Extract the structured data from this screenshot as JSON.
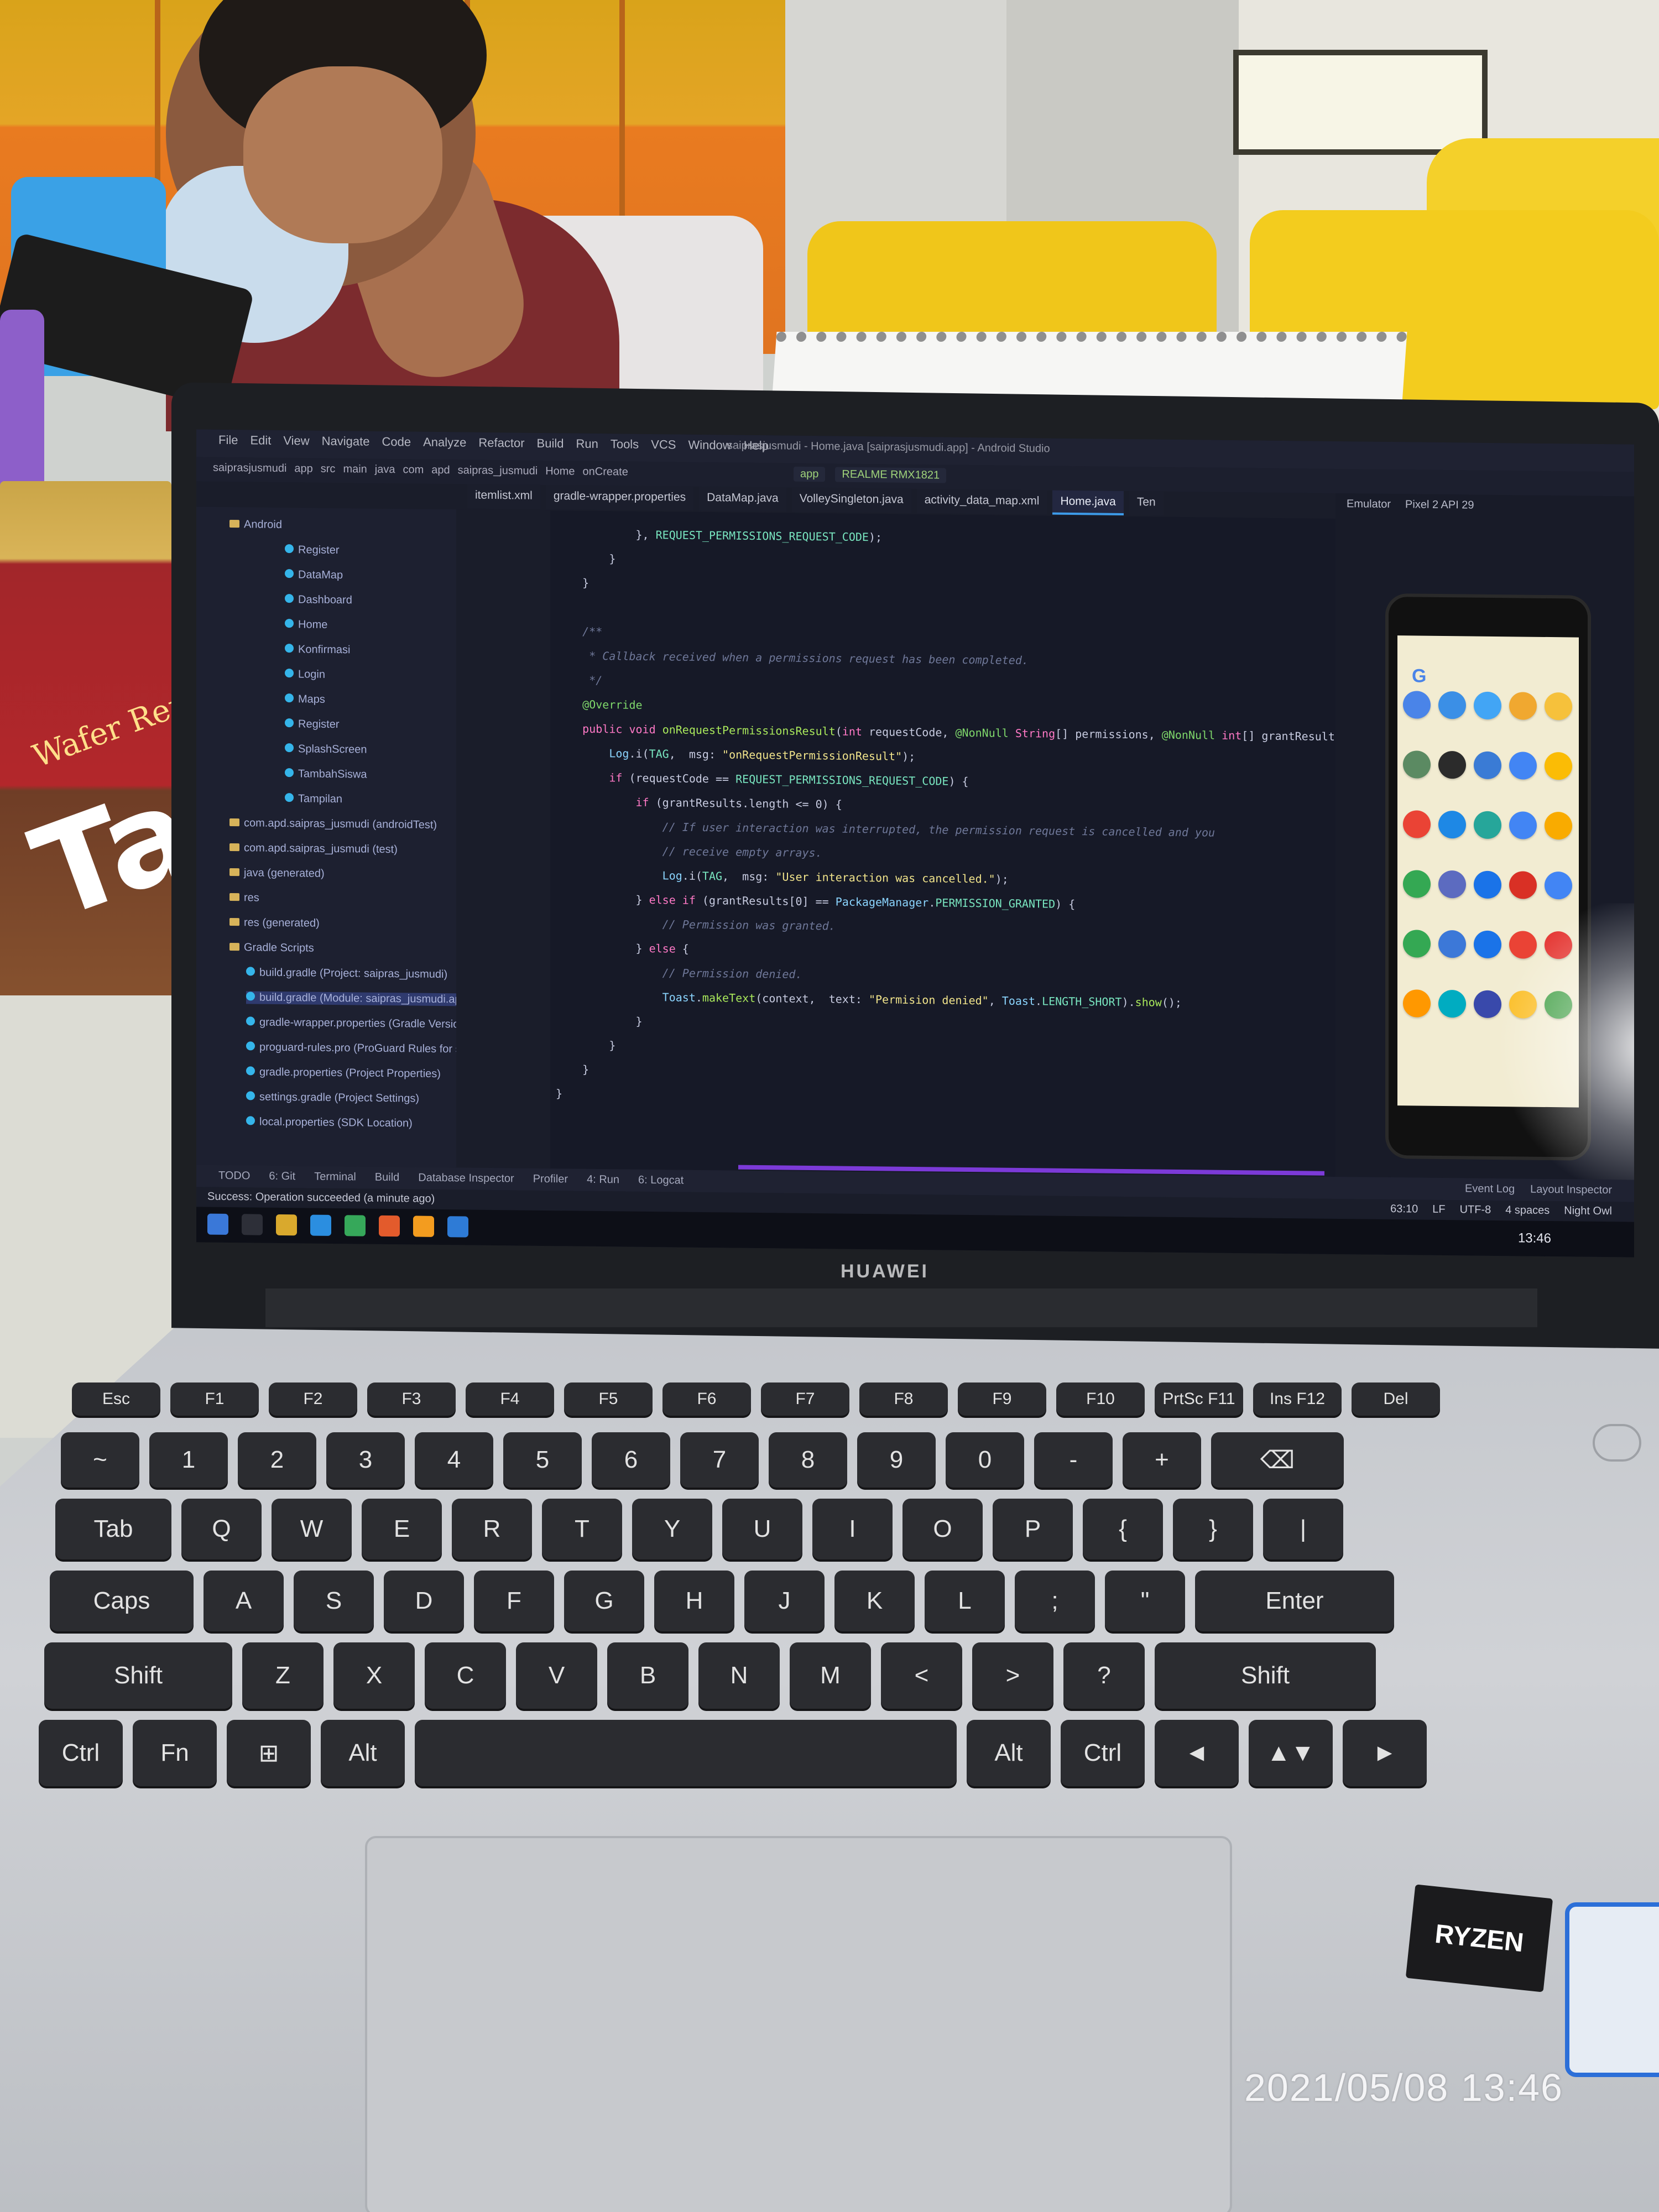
{
  "photo": {
    "timestamp": "2021/05/08 13:46",
    "laptop_brand": "HUAWEI",
    "cpu_sticker": "RYZEN",
    "snack_brand": "Tan",
    "snack_sub": "Wafer Renyah"
  },
  "ide": {
    "window_title": "saiprasjusmudi - Home.java [saiprasjusmudi.app] - Android Studio",
    "menu": [
      "File",
      "Edit",
      "View",
      "Navigate",
      "Code",
      "Analyze",
      "Refactor",
      "Build",
      "Run",
      "Tools",
      "VCS",
      "Window",
      "Help"
    ],
    "breadcrumbs": [
      "saiprasjusmudi",
      "app",
      "src",
      "main",
      "java",
      "com",
      "apd",
      "saipras_jusmudi",
      "Home",
      "onCreate"
    ],
    "run_config": [
      "app",
      "REALME RMX1821"
    ],
    "tabs": [
      {
        "label": "itemlist.xml",
        "active": false
      },
      {
        "label": "gradle-wrapper.properties",
        "active": false
      },
      {
        "label": "DataMap.java",
        "active": false
      },
      {
        "label": "VolleySingleton.java",
        "active": false
      },
      {
        "label": "activity_data_map.xml",
        "active": false
      },
      {
        "label": "Home.java",
        "active": true
      },
      {
        "label": "Ten",
        "active": false
      }
    ],
    "project_tree": [
      {
        "label": "Android",
        "type": "header",
        "selected": false
      },
      {
        "label": "Register",
        "type": "file",
        "selected": false
      },
      {
        "label": "DataMap",
        "type": "file",
        "selected": false
      },
      {
        "label": "Dashboard",
        "type": "file",
        "selected": false
      },
      {
        "label": "Home",
        "type": "file",
        "selected": false
      },
      {
        "label": "Konfirmasi",
        "type": "file",
        "selected": false
      },
      {
        "label": "Login",
        "type": "file",
        "selected": false
      },
      {
        "label": "Maps",
        "type": "file",
        "selected": false
      },
      {
        "label": "Register",
        "type": "file",
        "selected": false
      },
      {
        "label": "SplashScreen",
        "type": "file",
        "selected": false
      },
      {
        "label": "TambahSiswa",
        "type": "file",
        "selected": false
      },
      {
        "label": "Tampilan",
        "type": "file",
        "selected": false
      },
      {
        "label": "com.apd.saipras_jusmudi (androidTest)",
        "type": "folder",
        "selected": false
      },
      {
        "label": "com.apd.saipras_jusmudi (test)",
        "type": "folder",
        "selected": false
      },
      {
        "label": "java (generated)",
        "type": "folder",
        "selected": false
      },
      {
        "label": "res",
        "type": "folder",
        "selected": false
      },
      {
        "label": "res (generated)",
        "type": "folder",
        "selected": false
      },
      {
        "label": "Gradle Scripts",
        "type": "folder",
        "selected": false
      },
      {
        "label": "build.gradle (Project: saipras_jusmudi)",
        "type": "gradle",
        "selected": false
      },
      {
        "label": "build.gradle (Module: saipras_jusmudi.app)",
        "type": "gradle",
        "selected": true
      },
      {
        "label": "gradle-wrapper.properties (Gradle Version)",
        "type": "gradle",
        "selected": false
      },
      {
        "label": "proguard-rules.pro (ProGuard Rules for sa...)",
        "type": "gradle",
        "selected": false
      },
      {
        "label": "gradle.properties (Project Properties)",
        "type": "gradle",
        "selected": false
      },
      {
        "label": "settings.gradle (Project Settings)",
        "type": "gradle",
        "selected": false
      },
      {
        "label": "local.properties (SDK Location)",
        "type": "gradle",
        "selected": false
      }
    ],
    "code_lines": [
      "            }, REQUEST_PERMISSIONS_REQUEST_CODE);",
      "        }",
      "    }",
      "",
      "    /**",
      "     * Callback received when a permissions request has been completed.",
      "     */",
      "    @Override",
      "    public void onRequestPermissionsResult(int requestCode, @NonNull String[] permissions, @NonNull int[] grantResults) {",
      "        Log.i(TAG,  msg: \"onRequestPermissionResult\");",
      "        if (requestCode == REQUEST_PERMISSIONS_REQUEST_CODE) {",
      "            if (grantResults.length <= 0) {",
      "                // If user interaction was interrupted, the permission request is cancelled and you",
      "                // receive empty arrays.",
      "                Log.i(TAG,  msg: \"User interaction was cancelled.\");",
      "            } else if (grantResults[0] == PackageManager.PERMISSION_GRANTED) {",
      "                // Permission was granted.",
      "            } else {",
      "                // Permission denied.",
      "                Toast.makeText(context,  text: \"Permision denied\", Toast.LENGTH_SHORT).show();",
      "            }",
      "        }",
      "    }",
      "}"
    ],
    "emulator": {
      "title": "Emulator",
      "device": "Pixel 2 API 29"
    },
    "bottom_tools": [
      "TODO",
      "6: Git",
      "Terminal",
      "Build",
      "Database Inspector",
      "Profiler",
      "4: Run",
      "6: Logcat"
    ],
    "right_tools": [
      "Event Log",
      "Layout Inspector"
    ],
    "status_right": [
      "63:10",
      "LF",
      "UTF-8",
      "4 spaces",
      "Night Owl"
    ],
    "message": "Success: Operation succeeded (a minute ago)",
    "taskbar_clock": "13:46",
    "accent_colors": {
      "active_tab": "#3d9be9",
      "annotation": "#7fd86b",
      "string": "#f1e48b",
      "keyword": "#ff79c6"
    }
  },
  "keyboard": {
    "rows": [
      [
        "Esc",
        "F1",
        "F2",
        "F3",
        "F4",
        "F5",
        "F6",
        "F7",
        "F8",
        "F9",
        "F10",
        "PrtSc F11",
        "Ins F12",
        "Del"
      ],
      [
        "~",
        "1",
        "2",
        "3",
        "4",
        "5",
        "6",
        "7",
        "8",
        "9",
        "0",
        "-",
        "+",
        "⌫"
      ],
      [
        "Tab",
        "Q",
        "W",
        "E",
        "R",
        "T",
        "Y",
        "U",
        "I",
        "O",
        "P",
        "{",
        "}",
        "|"
      ],
      [
        "Caps",
        "A",
        "S",
        "D",
        "F",
        "G",
        "H",
        "J",
        "K",
        "L",
        ";",
        "\"",
        "Enter"
      ],
      [
        "Shift",
        "Z",
        "X",
        "C",
        "V",
        "B",
        "N",
        "M",
        "<",
        ">",
        "?",
        "Shift"
      ],
      [
        "Ctrl",
        "Fn",
        "⊞",
        "Alt",
        "",
        "Alt",
        "Ctrl",
        "◄",
        "▲▼",
        "►"
      ]
    ]
  }
}
